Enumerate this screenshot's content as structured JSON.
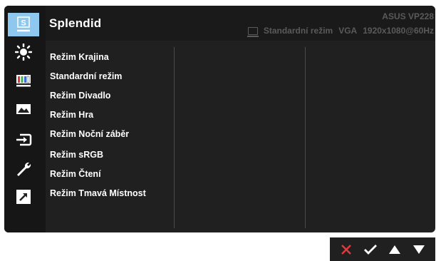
{
  "header": {
    "title": "Splendid",
    "model": "ASUS  VP228",
    "status_mode": "Standardní režim",
    "status_input": "VGA",
    "status_resolution": "1920x1080@60Hz"
  },
  "sidebar": {
    "selected_badge": "S",
    "items": [
      {
        "icon": "splendid-icon",
        "selected": true
      },
      {
        "icon": "brightness-icon"
      },
      {
        "icon": "color-bars-icon"
      },
      {
        "icon": "image-icon"
      },
      {
        "icon": "input-select-icon"
      },
      {
        "icon": "wrench-icon"
      },
      {
        "icon": "shortcut-arrow-icon"
      }
    ]
  },
  "modes": [
    "Režim Krajina",
    "Standardní režim",
    "Režim Divadlo",
    "Režim Hra",
    "Režim Noční záběr",
    "Režim sRGB",
    "Režim Čtení",
    "Režim Tmavá Místnost"
  ],
  "navbar": {
    "buttons": [
      "close-icon",
      "check-icon",
      "up-arrow-icon",
      "down-arrow-icon"
    ]
  },
  "colors": {
    "background": "#202020",
    "selected_tile": "#8ec8ef",
    "accent_red": "#e0393e",
    "text": "#ffffff",
    "muted": "#5a5a5a"
  }
}
